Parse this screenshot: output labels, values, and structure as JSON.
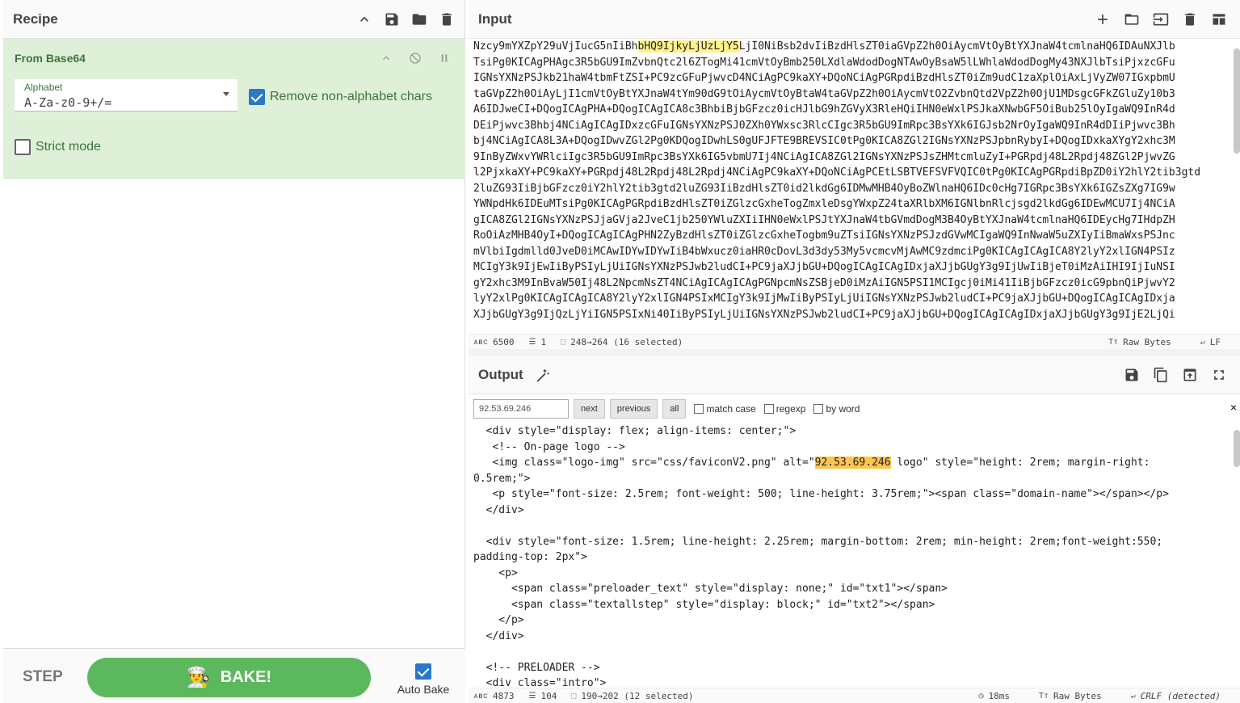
{
  "recipe": {
    "title": "Recipe",
    "operation": {
      "name": "From Base64",
      "alphabet_label": "Alphabet",
      "alphabet_value": "A-Za-z0-9+/=",
      "remove_non_alphabet_label": "Remove non-alphabet chars",
      "remove_non_alphabet_checked": true,
      "strict_mode_label": "Strict mode",
      "strict_mode_checked": false
    },
    "step_label": "STEP",
    "bake_label": "BAKE!",
    "auto_bake_label": "Auto Bake",
    "auto_bake_checked": true
  },
  "input": {
    "title": "Input",
    "lines": [
      {
        "pre": "Nzcy9mYXZpY29uVjIucG5nIiBh",
        "hl": "bHQ9IjkyLjUzLjY5",
        "post": "LjI0NiBsb2dvIiBzdHlsZT0iaGVpZ2h0OiAycmVtOyBtYXJnaW4tcmlnaHQ6IDAuNXJlb"
      },
      {
        "pre": "TsiPg0KICAgPHAgc3R5bGU9ImZvbnQtc2l6ZTogMi41cmVtOyBmb250LXdlaWdodDogNTAwOyBsaW5lLWhlaWdodDogMy43NXJlbTsiPjxzcGFu",
        "hl": "",
        "post": ""
      },
      {
        "pre": "IGNsYXNzPSJkb21haW4tbmFtZSI+PC9zcGFuPjwvcD4NCiAgPC9kaXY+DQoNCiAgPGRpdiBzdHlsZT0iZm9udC1zaXplOiAxLjVyZW07IGxpbmU",
        "hl": "",
        "post": ""
      },
      {
        "pre": "taGVpZ2h0OiAyLjI1cmVtOyBtYXJnaW4tYm90dG9tOiAycmVtOyBtaW4taGVpZ2h0OiAycmVtO2ZvbnQtd2VpZ2h0OjU1MDsgcGFkZGluZy10b3",
        "hl": "",
        "post": ""
      },
      {
        "pre": "A6IDJweCI+DQogICAgPHA+DQogICAgICA8c3BhbiBjbGFzcz0icHJlbG9hZGVyX3RleHQiIHN0eWxlPSJkaXNwbGF5OiBub25lOyIgaWQ9InR4d",
        "hl": "",
        "post": ""
      },
      {
        "pre": "DEiPjwvc3Bhbj4NCiAgICAgIDxzcGFuIGNsYXNzPSJ0ZXh0YWxsc3RlcCIgc3R5bGU9ImRpc3BsYXk6IGJsb2NrOyIgaWQ9InR4dDIiPjwvc3Bh",
        "hl": "",
        "post": ""
      },
      {
        "pre": "bj4NCiAgICA8L3A+DQogIDwvZGl2Pg0KDQogIDwhLS0gUFJFTE9BREVSIC0tPg0KICA8ZGl2IGNsYXNzPSJpbnRybyI+DQogIDxkaXYgY2xhc3M",
        "hl": "",
        "post": ""
      },
      {
        "pre": "9InByZWxvYWRlciIgc3R5bGU9ImRpc3BsYXk6IG5vbmU7Ij4NCiAgICA8ZGl2IGNsYXNzPSJsZHMtcmluZyI+PGRpdj48L2Rpdj48ZGl2PjwvZG",
        "hl": "",
        "post": ""
      },
      {
        "pre": "l2PjxkaXY+PC9kaXY+PGRpdj48L2Rpdj48L2Rpdj4NCiAgPC9kaXY+DQoNCiAgPCEtLSBTVEFSVFVQIC0tPg0KICAgPGRpdiBpZD0iY2hlY2tib3gtd",
        "hl": "",
        "post": ""
      },
      {
        "pre": "2luZG93IiBjbGFzcz0iY2hlY2tib3gtd2luZG93IiBzdHlsZT0id2lkdGg6IDMwMHB4OyBoZWlnaHQ6IDc0cHg7IGRpc3BsYXk6IGZsZXg7IG9w",
        "hl": "",
        "post": ""
      },
      {
        "pre": "YWNpdHk6IDEuMTsiPg0KICAgPGRpdiBzdHlsZT0iZGlzcGxheTogZmxleDsgYWxpZ24taXRlbXM6IGNlbnRlcjsgd2lkdGg6IDEwMCU7Ij4NCiA",
        "hl": "",
        "post": ""
      },
      {
        "pre": "gICA8ZGl2IGNsYXNzPSJjaGVja2JveC1jb250YWluZXIiIHN0eWxlPSJtYXJnaW4tbGVmdDogM3B4OyBtYXJnaW4tcmlnaHQ6IDEycHg7IHdpZH",
        "hl": "",
        "post": ""
      },
      {
        "pre": "RoOiAzMHB4OyI+DQogICAgICAgPHN2ZyBzdHlsZT0iZGlzcGxheTogbm9uZTsiIGNsYXNzPSJzdGVwMCIgaWQ9InNwaW5uZXIyIiBmaWxsPSJnc",
        "hl": "",
        "post": ""
      },
      {
        "pre": "mVlbiIgdmlld0JveD0iMCAwIDYwIDYwIiB4bWxucz0iaHR0cDovL3d3dy53My5vcmcvMjAwMC9zdmciPg0KICAgICAgICA8Y2lyY2xlIGN4PSIz",
        "hl": "",
        "post": ""
      },
      {
        "pre": "MCIgY3k9IjEwIiByPSIyLjUiIGNsYXNzPSJwb2ludCI+PC9jaXJjbGU+DQogICAgICAgIDxjaXJjbGUgY3g9IjUwIiBjeT0iMzAiIHI9IjIuNSI",
        "hl": "",
        "post": ""
      },
      {
        "pre": "gY2xhc3M9InBvaW50Ij48L2NpcmNsZT4NCiAgICAgICAgPGNpcmNsZSBjeD0iMzAiIGN5PSI1MCIgcj0iMi41IiBjbGFzcz0icG9pbnQiPjwvY2",
        "hl": "",
        "post": ""
      },
      {
        "pre": "lyY2xlPg0KICAgICAgICA8Y2lyY2xlIGN4PSIxMCIgY3k9IjMwIiByPSIyLjUiIGNsYXNzPSJwb2ludCI+PC9jaXJjbGU+DQogICAgICAgIDxja",
        "hl": "",
        "post": ""
      },
      {
        "pre": "XJjbGUgY3g9IjQzLjYiIGN5PSIxNi40IiByPSIyLjUiIGNsYXNzPSJwb2ludCI+PC9jaXJjbGU+DQogICAgICAgIDxjaXJjbGUgY3g9IjE2LjQi",
        "hl": "",
        "post": ""
      }
    ],
    "status": {
      "length": "6500",
      "lines": "1",
      "selection": "248→264 (16 selected)",
      "encoding": "Raw Bytes",
      "eol": "LF"
    }
  },
  "output": {
    "title": "Output",
    "search": {
      "value": "92.53.69.246",
      "next": "next",
      "previous": "previous",
      "all": "all",
      "match_case": "match case",
      "regexp": "regexp",
      "by_word": "by word",
      "close": "×"
    },
    "lines": [
      {
        "pre": "  <div style=\"display: flex; align-items: center;\">",
        "hl": "",
        "post": ""
      },
      {
        "pre": "   <!-- On-page logo -->",
        "hl": "",
        "post": ""
      },
      {
        "pre": "   <img class=\"logo-img\" src=\"css/faviconV2.png\" alt=\"",
        "hl": "92.53.69.246",
        "post": " logo\" style=\"height: 2rem; margin-right:"
      },
      {
        "pre": "0.5rem;\">",
        "hl": "",
        "post": ""
      },
      {
        "pre": "   <p style=\"font-size: 2.5rem; font-weight: 500; line-height: 3.75rem;\"><span class=\"domain-name\"></span></p>",
        "hl": "",
        "post": ""
      },
      {
        "pre": "  </div>",
        "hl": "",
        "post": ""
      },
      {
        "pre": "",
        "hl": "",
        "post": ""
      },
      {
        "pre": "  <div style=\"font-size: 1.5rem; line-height: 2.25rem; margin-bottom: 2rem; min-height: 2rem;font-weight:550;",
        "hl": "",
        "post": ""
      },
      {
        "pre": "padding-top: 2px\">",
        "hl": "",
        "post": ""
      },
      {
        "pre": "    <p>",
        "hl": "",
        "post": ""
      },
      {
        "pre": "      <span class=\"preloader_text\" style=\"display: none;\" id=\"txt1\"></span>",
        "hl": "",
        "post": ""
      },
      {
        "pre": "      <span class=\"textallstep\" style=\"display: block;\" id=\"txt2\"></span>",
        "hl": "",
        "post": ""
      },
      {
        "pre": "    </p>",
        "hl": "",
        "post": ""
      },
      {
        "pre": "  </div>",
        "hl": "",
        "post": ""
      },
      {
        "pre": "",
        "hl": "",
        "post": ""
      },
      {
        "pre": "  <!-- PRELOADER -->",
        "hl": "",
        "post": ""
      },
      {
        "pre": "  <div class=\"intro\">",
        "hl": "",
        "post": ""
      }
    ],
    "status": {
      "length": "4873",
      "lines": "104",
      "selection": "190→202 (12 selected)",
      "time": "18ms",
      "encoding": "Raw Bytes",
      "eol": "CRLF (detected)"
    }
  }
}
